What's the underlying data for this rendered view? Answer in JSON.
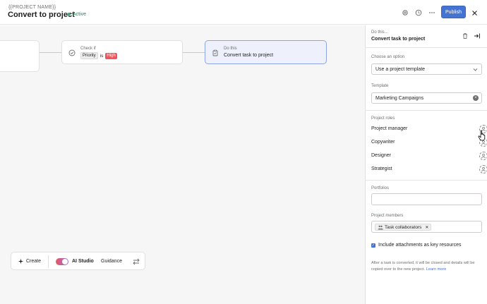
{
  "header": {
    "project_name": "{{PROJECT NAME}}",
    "title": "Convert to project",
    "status": "Active",
    "publish_label": "Publish",
    "icons": [
      "settings-icon",
      "history-icon",
      "more-icon",
      "close-icon"
    ]
  },
  "canvas": {
    "check_node": {
      "label": "Check if",
      "field": "Priority",
      "operator": "is",
      "value": "High"
    },
    "do_node": {
      "label": "Do this",
      "title": "Convert task to project"
    }
  },
  "toolbar": {
    "create_label": "Create",
    "ai_studio_label": "AI Studio",
    "guidance_label": "Guidance"
  },
  "panel": {
    "subtitle": "Do this...",
    "title": "Convert task to project",
    "option_label": "Choose an option",
    "option_value": "Use a project template",
    "template_label": "Template",
    "template_value": "Marketing Campaigns",
    "roles_label": "Project roles",
    "roles": [
      {
        "label": "Project manager"
      },
      {
        "label": "Copywriter"
      },
      {
        "label": "Designer"
      },
      {
        "label": "Strategist"
      }
    ],
    "portfolios_label": "Portfolios",
    "members_label": "Project members",
    "member_chip": "Task collaborators",
    "checkbox_label": "Include attachments as key resources",
    "checkbox_checked": true,
    "note_text": "After a task is converted, it will be closed and details will be copied over to the new project.",
    "note_link": "Learn more"
  },
  "colors": {
    "accent": "#4573d2",
    "status_green": "#58a182",
    "high_red": "#e8585e"
  }
}
